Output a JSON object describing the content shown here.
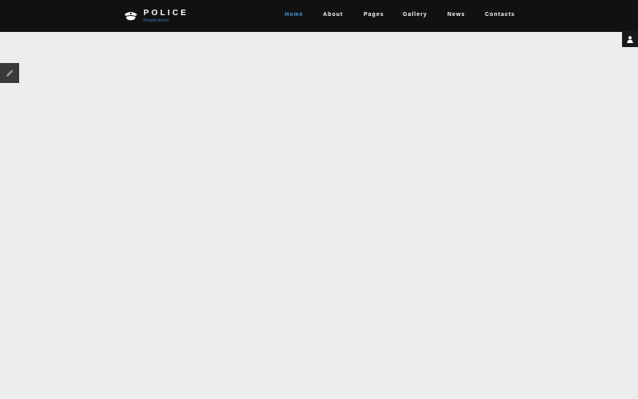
{
  "header": {
    "logo": {
      "title": "POLICE",
      "subtitle": "Department",
      "icon": "police-cap-icon"
    },
    "nav": [
      {
        "label": "Home",
        "active": true
      },
      {
        "label": "About",
        "active": false
      },
      {
        "label": "Pages",
        "active": false
      },
      {
        "label": "Gallery",
        "active": false
      },
      {
        "label": "News",
        "active": false
      },
      {
        "label": "Contacts",
        "active": false
      }
    ]
  },
  "side_tabs": {
    "left_icon": "pencil-icon",
    "right_icon": "user-icon"
  },
  "colors": {
    "header_bg": "#111111",
    "page_bg": "#ededed",
    "accent": "#4c9cdc"
  }
}
